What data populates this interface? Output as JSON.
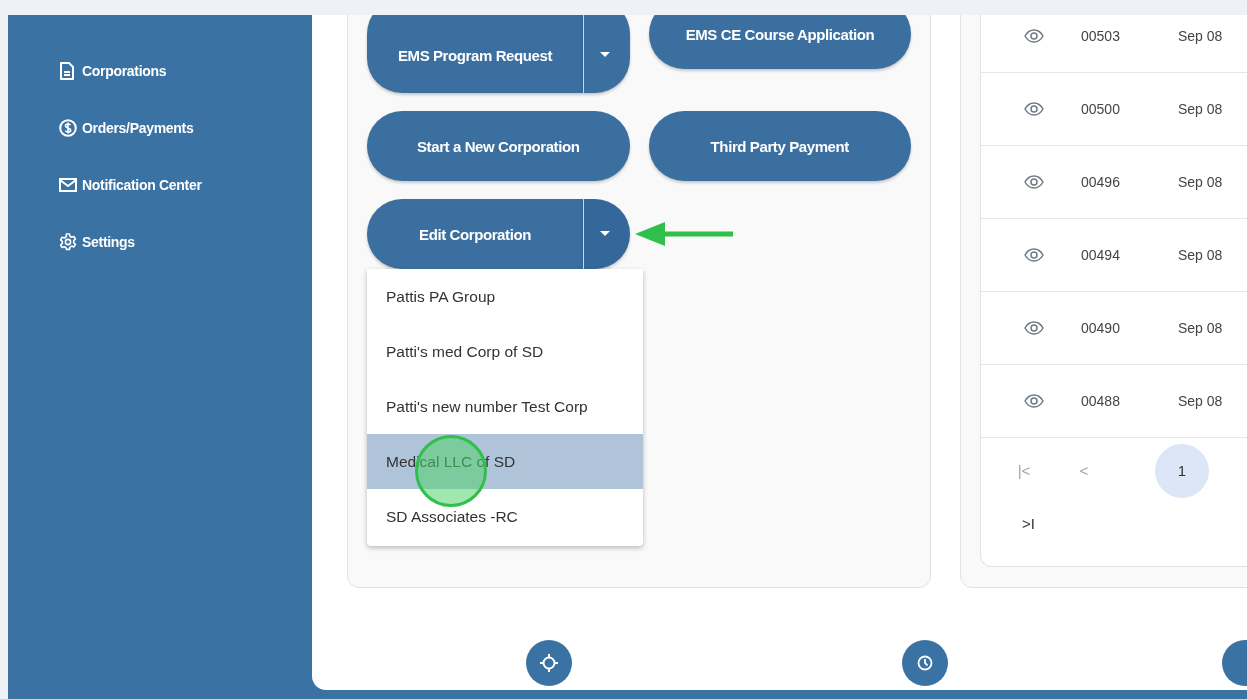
{
  "sidebar": {
    "items": [
      {
        "label": "Corporations"
      },
      {
        "label": "Orders/Payments"
      },
      {
        "label": "Notification Center"
      },
      {
        "label": "Settings"
      }
    ]
  },
  "actions": [
    {
      "label": "EMS Program Request",
      "split": true,
      "expanded": false
    },
    {
      "label": "EMS CE Course Application",
      "split": false
    },
    {
      "label": "Start a New Corporation",
      "split": false
    },
    {
      "label": "Third Party Payment",
      "split": false
    },
    {
      "label": "Edit Corporation",
      "split": true,
      "expanded": true
    }
  ],
  "dropdown_menu": {
    "items": [
      {
        "label": "Pattis PA Group",
        "selected": false
      },
      {
        "label": "Patti's med Corp of SD",
        "selected": false
      },
      {
        "label": "Patti's new number Test Corp",
        "selected": false
      },
      {
        "label": "Medical LLC of SD",
        "selected": true
      },
      {
        "label": "SD Associates -RC",
        "selected": false
      }
    ]
  },
  "table": {
    "rows": [
      {
        "id": "00503",
        "date": "Sep 08"
      },
      {
        "id": "00500",
        "date": "Sep 08"
      },
      {
        "id": "00496",
        "date": "Sep 08"
      },
      {
        "id": "00494",
        "date": "Sep 08"
      },
      {
        "id": "00490",
        "date": "Sep 08"
      },
      {
        "id": "00488",
        "date": "Sep 08"
      }
    ]
  },
  "pagination": {
    "first": {
      "label": "|<",
      "disabled": true
    },
    "prev": {
      "label": "<",
      "disabled": true
    },
    "pages": [
      {
        "label": "1",
        "selected": true
      }
    ],
    "last": {
      "label": ">I",
      "disabled": false
    }
  }
}
